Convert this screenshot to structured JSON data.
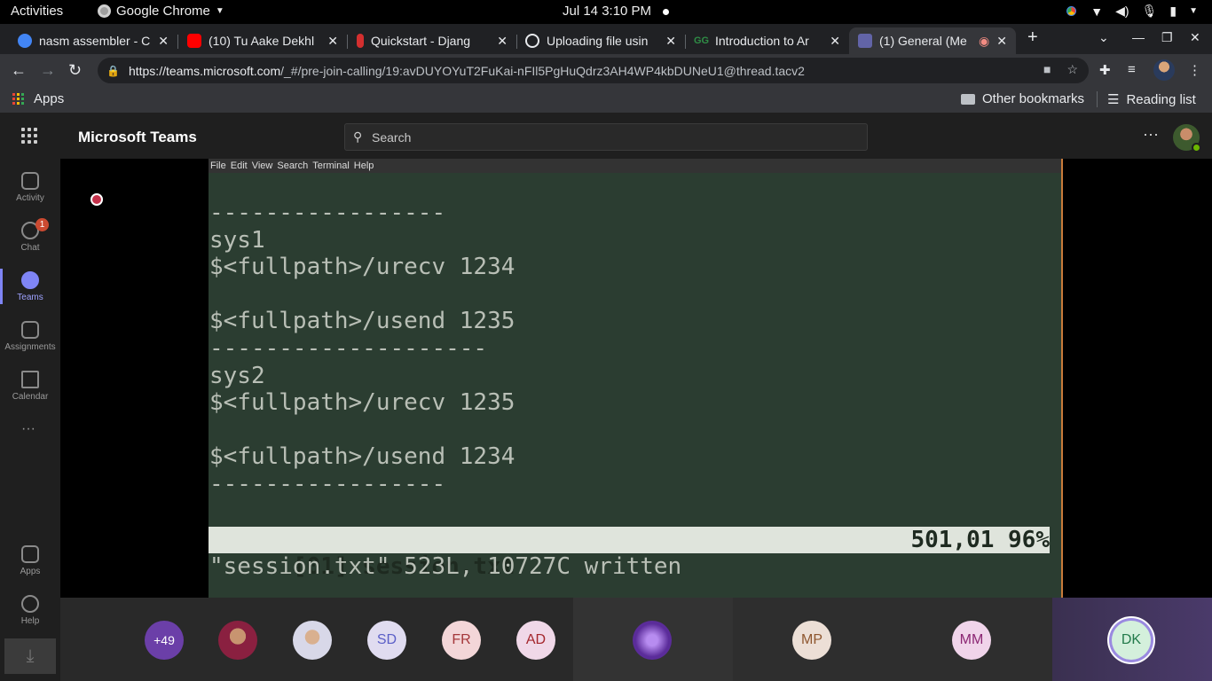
{
  "system": {
    "activities": "Activities",
    "app_menu": "Google Chrome",
    "clock": "Jul 14  3:10 PM"
  },
  "tabs": [
    {
      "title": "nasm assembler - C",
      "favicon_color": "#4285f4"
    },
    {
      "title": "(10) Tu Aake Dekhl",
      "favicon_color": "#ff0000"
    },
    {
      "title": "Quickstart - Djang",
      "favicon_color": "#d32f2f"
    },
    {
      "title": "Uploading file usin",
      "favicon_color": "#e8eaed"
    },
    {
      "title": "Introduction to Ar",
      "favicon_color": "#2f8d46"
    },
    {
      "title": "(1) General (Me",
      "favicon_color": "#6264a7"
    }
  ],
  "address": {
    "host": "https://teams.microsoft.com",
    "path": "/_#/pre-join-calling/19:avDUYOYuT2FuKai-nFIl5PgHuQdrz3AH4WP4kbDUNeU1@thread.tacv2"
  },
  "bookmarks": {
    "apps": "Apps",
    "other": "Other bookmarks",
    "reading": "Reading list"
  },
  "teams": {
    "app_name": "Microsoft Teams",
    "search_placeholder": "Search",
    "rail": [
      {
        "label": "Activity",
        "icon": "bell-icon"
      },
      {
        "label": "Chat",
        "icon": "chat-icon",
        "badge": "1"
      },
      {
        "label": "Teams",
        "icon": "teams-icon"
      },
      {
        "label": "Assignments",
        "icon": "assignments-icon"
      },
      {
        "label": "Calendar",
        "icon": "calendar-icon"
      },
      {
        "label": "Apps",
        "icon": "apps-icon"
      },
      {
        "label": "Help",
        "icon": "help-icon"
      }
    ]
  },
  "terminal": {
    "menu": [
      "File",
      "Edit",
      "View",
      "Search",
      "Terminal",
      "Help"
    ],
    "lines": [
      "-----------------",
      "sys1",
      "$<fullpath>/urecv 1234",
      "",
      "$<fullpath>/usend 1235",
      "--------------------",
      "sys2",
      "$<fullpath>/urecv 1235",
      "",
      "$<fullpath>/usend 1234",
      "-----------------"
    ],
    "status_file": "[01] session.txt",
    "status_pos": "501,01 96%",
    "message": "\"session.txt\" 523L, 10727C written"
  },
  "participants": {
    "overflow": "+49",
    "avatars": [
      {
        "initials": "",
        "bg": "#8a2040"
      },
      {
        "initials": "",
        "bg": "#d8d8e8"
      },
      {
        "initials": "SD",
        "bg": "#e0dcf0"
      },
      {
        "initials": "FR",
        "bg": "#f3d6d8"
      },
      {
        "initials": "AD",
        "bg": "#f0d8e8"
      },
      {
        "initials": "",
        "bg": "#5b2c9a"
      },
      {
        "initials": "MP",
        "bg": "#ecdfd6"
      },
      {
        "initials": "MM",
        "bg": "#f0d4ea"
      },
      {
        "initials": "DK",
        "bg": "#d4f0dc"
      }
    ]
  }
}
